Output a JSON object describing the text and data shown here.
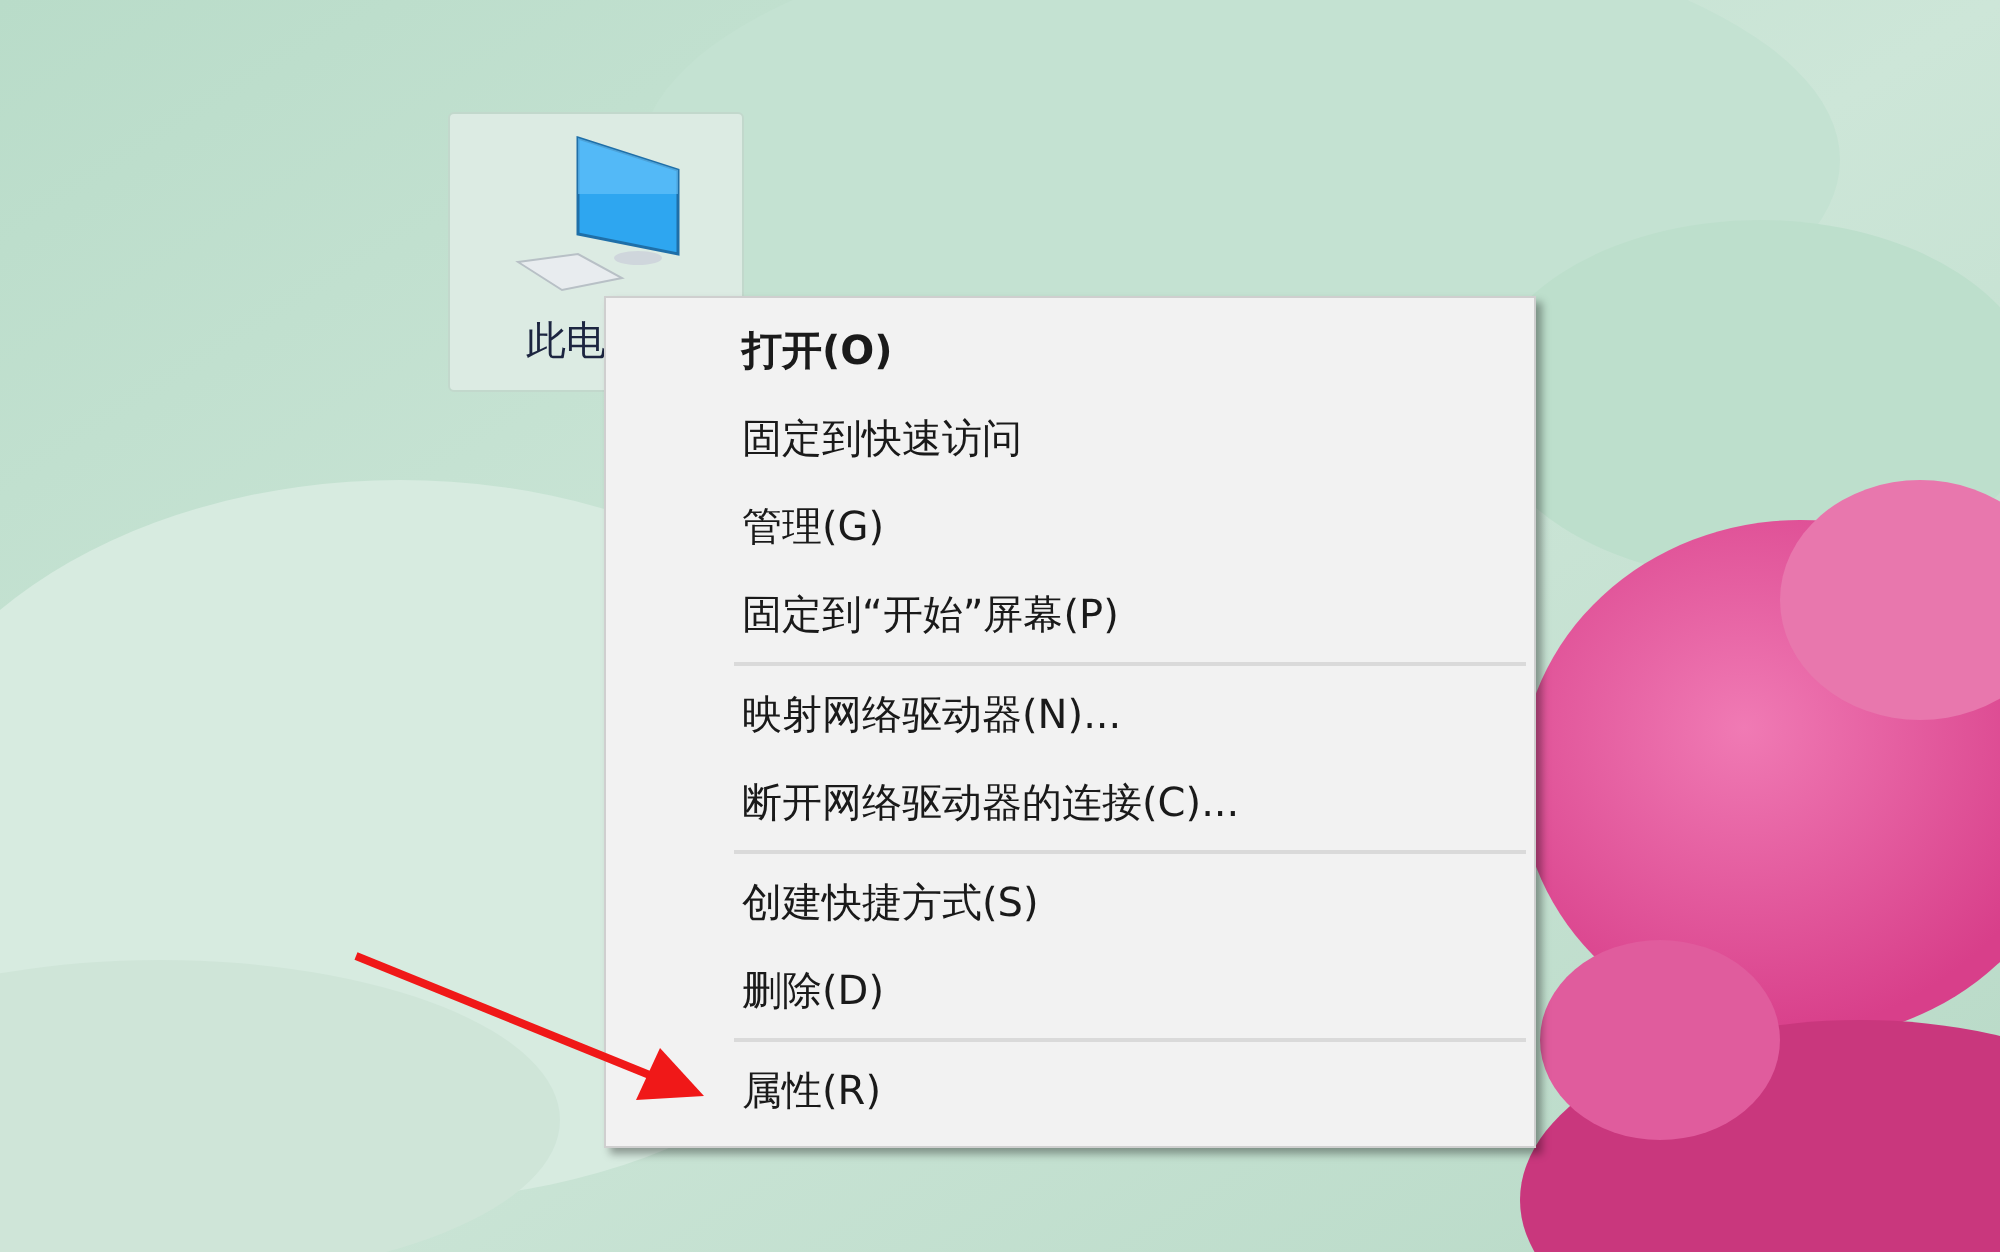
{
  "desktop_icon": {
    "label": "此电",
    "selected": true
  },
  "context_menu": {
    "items": [
      {
        "kind": "item",
        "label": "打开(O)",
        "default": true
      },
      {
        "kind": "item",
        "label": "固定到快速访问",
        "default": false
      },
      {
        "kind": "item",
        "label": "管理(G)",
        "default": false
      },
      {
        "kind": "item",
        "label": "固定到“开始”屏幕(P)",
        "default": false
      },
      {
        "kind": "separator"
      },
      {
        "kind": "item",
        "label": "映射网络驱动器(N)...",
        "default": false
      },
      {
        "kind": "item",
        "label": "断开网络驱动器的连接(C)...",
        "default": false
      },
      {
        "kind": "separator"
      },
      {
        "kind": "item",
        "label": "创建快捷方式(S)",
        "default": false
      },
      {
        "kind": "item",
        "label": "删除(D)",
        "default": false
      },
      {
        "kind": "separator"
      },
      {
        "kind": "item",
        "label": "属性(R)",
        "default": false
      }
    ]
  }
}
